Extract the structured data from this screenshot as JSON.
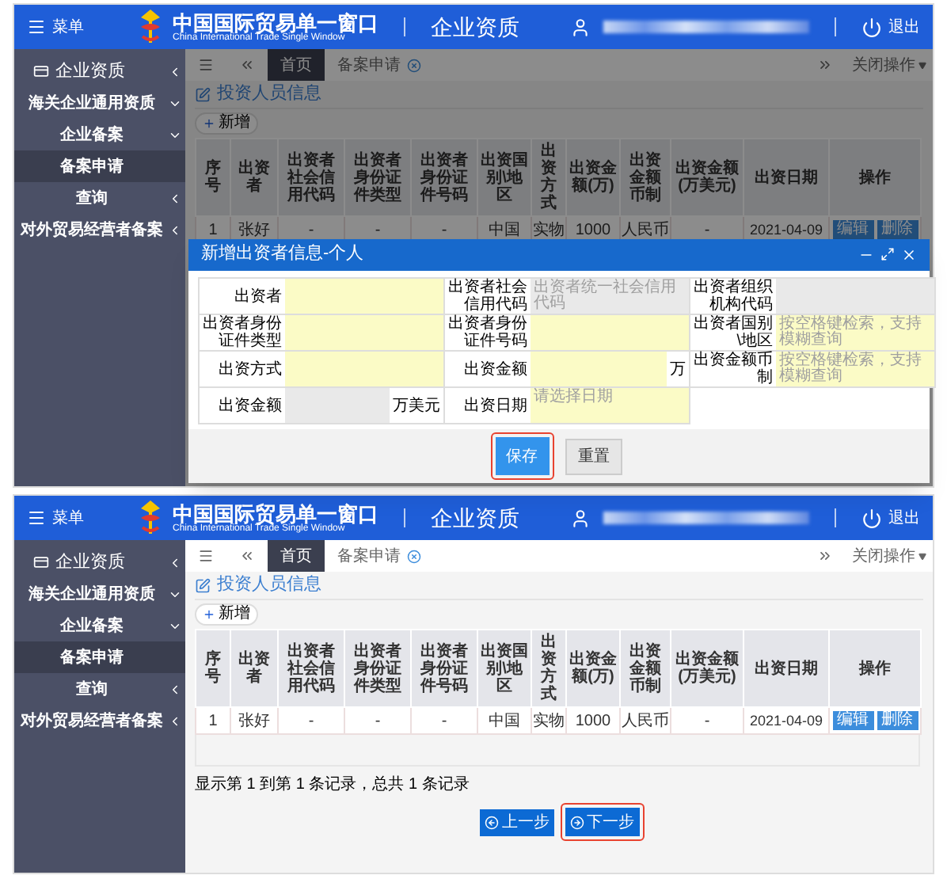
{
  "screens": [
    {
      "header": {
        "menu_label": "菜单",
        "brand_title": "中国国际贸易单一窗口",
        "brand_subtitle": "China International Trade Single Window",
        "module": "企业资质",
        "logout": "退出"
      },
      "sidebar": {
        "items": [
          {
            "label": "企业资质",
            "expanded": false,
            "selected": false,
            "children": [
              {
                "label": "海关企业通用资质",
                "expanded": true,
                "selected": false,
                "children": [
                  {
                    "label": "企业备案",
                    "expanded": true,
                    "selected": false,
                    "children": [
                      {
                        "label": "备案申请",
                        "selected": true
                      }
                    ]
                  },
                  {
                    "label": "查询",
                    "expanded": false,
                    "selected": false
                  }
                ]
              },
              {
                "label": "对外贸易经营者备案",
                "expanded": false,
                "selected": false
              }
            ]
          }
        ]
      },
      "tabs": {
        "items": [
          {
            "label": "首页",
            "selected": true,
            "closable": false
          },
          {
            "label": "备案申请",
            "selected": false,
            "closable": true
          }
        ],
        "close_menu": "关闭操作"
      },
      "section": {
        "title": "投资人员信息",
        "add_button": "新增"
      },
      "table": {
        "columns": [
          "序号",
          "出资者",
          "出资者社会信用代码",
          "出资者身份证件类型",
          "出资者身份证件号码",
          "出资国别\\地区",
          "出资方式",
          "出资金额(万)",
          "出资金额币制",
          "出资金额(万美元)",
          "出资日期",
          "操作"
        ],
        "rows": [
          {
            "cells": [
              "1",
              "张好",
              "-",
              "-",
              "-",
              "中国",
              "实物",
              "1000",
              "人民币",
              "-",
              "2021-04-09"
            ],
            "actions": [
              "编辑",
              "删除"
            ]
          }
        ]
      },
      "dialog": {
        "title": "新增出资者信息-个人",
        "rows": [
          [
            {
              "label": "出资者",
              "disabled": false
            },
            {
              "label": "出资者社会信用代码",
              "placeholder": "出资者统一社会信用代码",
              "disabled": true
            },
            {
              "label": "出资者组织机构代码",
              "disabled": true
            }
          ],
          [
            {
              "label": "出资者身份证件类型",
              "disabled": false
            },
            {
              "label": "出资者身份证件号码",
              "disabled": false
            },
            {
              "label": "出资者国别\\地区",
              "placeholder": "按空格键检索，支持模糊查询",
              "disabled": false
            }
          ],
          [
            {
              "label": "出资方式",
              "disabled": false
            },
            {
              "label": "出资金额",
              "unit": "万",
              "disabled": false
            },
            {
              "label": "出资金额币制",
              "placeholder": "按空格键检索，支持模糊查询",
              "disabled": false
            }
          ],
          [
            {
              "label": "出资金额",
              "unit": "万美元",
              "disabled": true
            },
            {
              "label": "出资日期",
              "placeholder": "请选择日期",
              "disabled": false
            }
          ]
        ],
        "buttons": [
          {
            "label": "保存",
            "kind": "primary",
            "highlighted": true
          },
          {
            "label": "重置",
            "kind": "default",
            "highlighted": false
          }
        ]
      }
    },
    {
      "header": {
        "menu_label": "菜单",
        "brand_title": "中国国际贸易单一窗口",
        "brand_subtitle": "China International Trade Single Window",
        "module": "企业资质",
        "logout": "退出"
      },
      "sidebar": {
        "items": [
          {
            "label": "企业资质",
            "expanded": false,
            "selected": false,
            "children": [
              {
                "label": "海关企业通用资质",
                "expanded": true,
                "selected": false,
                "children": [
                  {
                    "label": "企业备案",
                    "expanded": true,
                    "selected": false,
                    "children": [
                      {
                        "label": "备案申请",
                        "selected": true
                      }
                    ]
                  },
                  {
                    "label": "查询",
                    "expanded": false,
                    "selected": false
                  }
                ]
              },
              {
                "label": "对外贸易经营者备案",
                "expanded": false,
                "selected": false
              }
            ]
          }
        ]
      },
      "tabs": {
        "items": [
          {
            "label": "首页",
            "selected": true,
            "closable": false
          },
          {
            "label": "备案申请",
            "selected": false,
            "closable": true
          }
        ],
        "close_menu": "关闭操作"
      },
      "section": {
        "title": "投资人员信息",
        "add_button": "新增"
      },
      "table": {
        "columns": [
          "序号",
          "出资者",
          "出资者社会信用代码",
          "出资者身份证件类型",
          "出资者身份证件号码",
          "出资国别\\地区",
          "出资方式",
          "出资金额(万)",
          "出资金额币制",
          "出资金额(万美元)",
          "出资日期",
          "操作"
        ],
        "rows": [
          {
            "cells": [
              "1",
              "张好",
              "-",
              "-",
              "-",
              "中国",
              "实物",
              "1000",
              "人民币",
              "-",
              "2021-04-09"
            ],
            "actions": [
              "编辑",
              "删除"
            ]
          }
        ]
      },
      "pager": {
        "summary": "显示第 1 到第 1 条记录，总共 1 条记录",
        "buttons": [
          {
            "label": "上一步",
            "kind": "prev",
            "highlighted": false
          },
          {
            "label": "下一步",
            "kind": "next",
            "highlighted": true
          }
        ]
      }
    }
  ]
}
